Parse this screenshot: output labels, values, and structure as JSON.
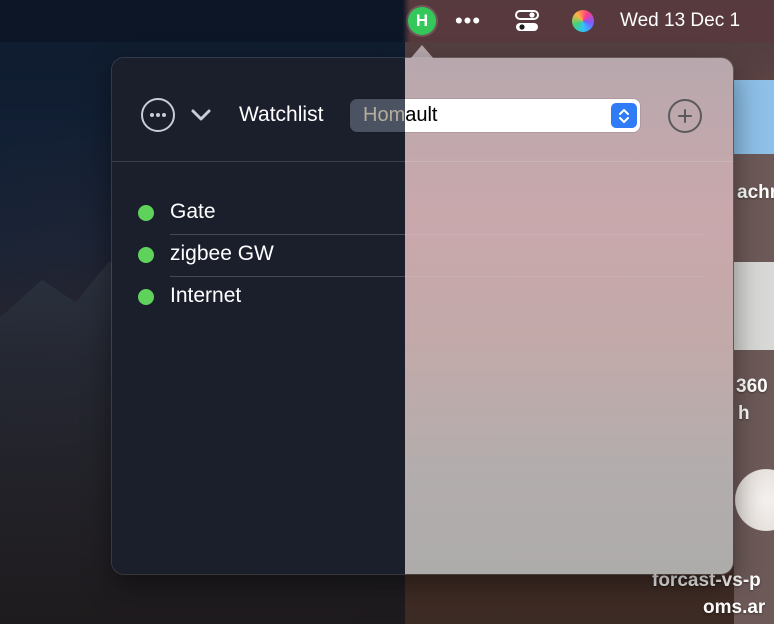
{
  "menubar": {
    "app_badge": "H",
    "more_icon": "•••",
    "clock": "Wed 13 Dec  1"
  },
  "popover": {
    "toolbar": {
      "watchlist_label": "Watchlist",
      "selected_watchlist": "Homault"
    },
    "items": [
      {
        "label": "Gate",
        "status": "online",
        "status_color": "#5fd25c"
      },
      {
        "label": "zigbee GW",
        "status": "online",
        "status_color": "#5fd25c"
      },
      {
        "label": "Internet",
        "status": "online",
        "status_color": "#5fd25c"
      }
    ]
  },
  "background_window": {
    "text_1": "achr",
    "text_2": "360",
    "text_3": "h",
    "text_4": "forcast-vs-p",
    "text_5": "oms.ar"
  },
  "colors": {
    "accent": "#2f7cf6",
    "status_online": "#5fd25c",
    "app_badge": "#34c759"
  }
}
